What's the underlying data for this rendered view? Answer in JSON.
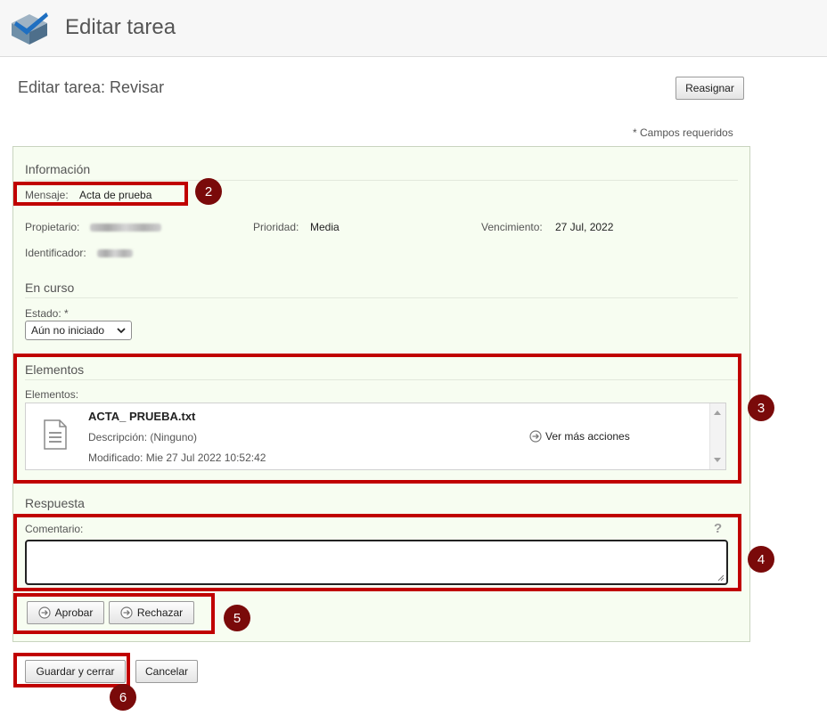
{
  "header": {
    "app_title": "Editar tarea",
    "logo_icon": "alfresco-logo-icon"
  },
  "page": {
    "title": "Editar tarea: Revisar",
    "reassign_label": "Reasignar",
    "required_star": "*",
    "required_note": "Campos requeridos"
  },
  "info": {
    "section_title": "Información",
    "message_label": "Mensaje:",
    "message_value": "Acta de prueba",
    "owner_label": "Propietario:",
    "priority_label": "Prioridad:",
    "priority_value": "Media",
    "due_label": "Vencimiento:",
    "due_value": "27 Jul, 2022",
    "identifier_label": "Identificador:"
  },
  "progress": {
    "section_title": "En curso",
    "status_label": "Estado:",
    "status_star": "*",
    "status_value": "Aún no iniciado"
  },
  "items": {
    "section_title": "Elementos",
    "list_label": "Elementos:",
    "list": [
      {
        "name": "ACTA_ PRUEBA.txt",
        "description": "Descripción: (Ninguno)",
        "modified": "Modificado: Mie 27 Jul 2022 10:52:42",
        "more_actions": "Ver más acciones"
      }
    ]
  },
  "response": {
    "section_title": "Respuesta",
    "comment_label": "Comentario:",
    "help_glyph": "?",
    "approve_label": "Aprobar",
    "reject_label": "Rechazar"
  },
  "footer": {
    "save_close_label": "Guardar y cerrar",
    "cancel_label": "Cancelar"
  },
  "annotations": {
    "color": "#c00000",
    "badge_color": "#7a0a0a",
    "badges": [
      "2",
      "3",
      "4",
      "5",
      "6"
    ]
  },
  "colors": {
    "panel_bg": "#f7fdf1",
    "panel_border": "#c9d4bf"
  }
}
